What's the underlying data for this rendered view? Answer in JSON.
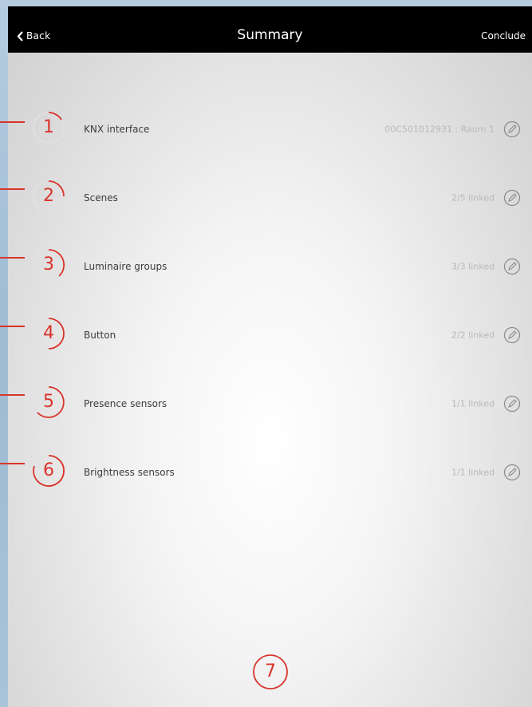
{
  "navbar": {
    "back_label": "Back",
    "title": "Summary",
    "conclude_label": "Conclude"
  },
  "rows": [
    {
      "number": "1",
      "label": "KNX interface",
      "value": "00C501012931 : Raum 1"
    },
    {
      "number": "2",
      "label": "Scenes",
      "value": "2/5 linked"
    },
    {
      "number": "3",
      "label": "Luminaire groups",
      "value": "3/3 linked"
    },
    {
      "number": "4",
      "label": "Button",
      "value": "2/2 linked"
    },
    {
      "number": "5",
      "label": "Presence sensors",
      "value": "1/1 linked"
    },
    {
      "number": "6",
      "label": "Brightness sensors",
      "value": "1/1 linked"
    }
  ],
  "conclude_marker": {
    "number": "7"
  },
  "colors": {
    "accent": "#d9342b",
    "navbar": "#000000",
    "value_text": "#b9b9b9"
  },
  "icons": {
    "back": "chevron-left-icon",
    "edit": "pencil-circle-icon"
  }
}
